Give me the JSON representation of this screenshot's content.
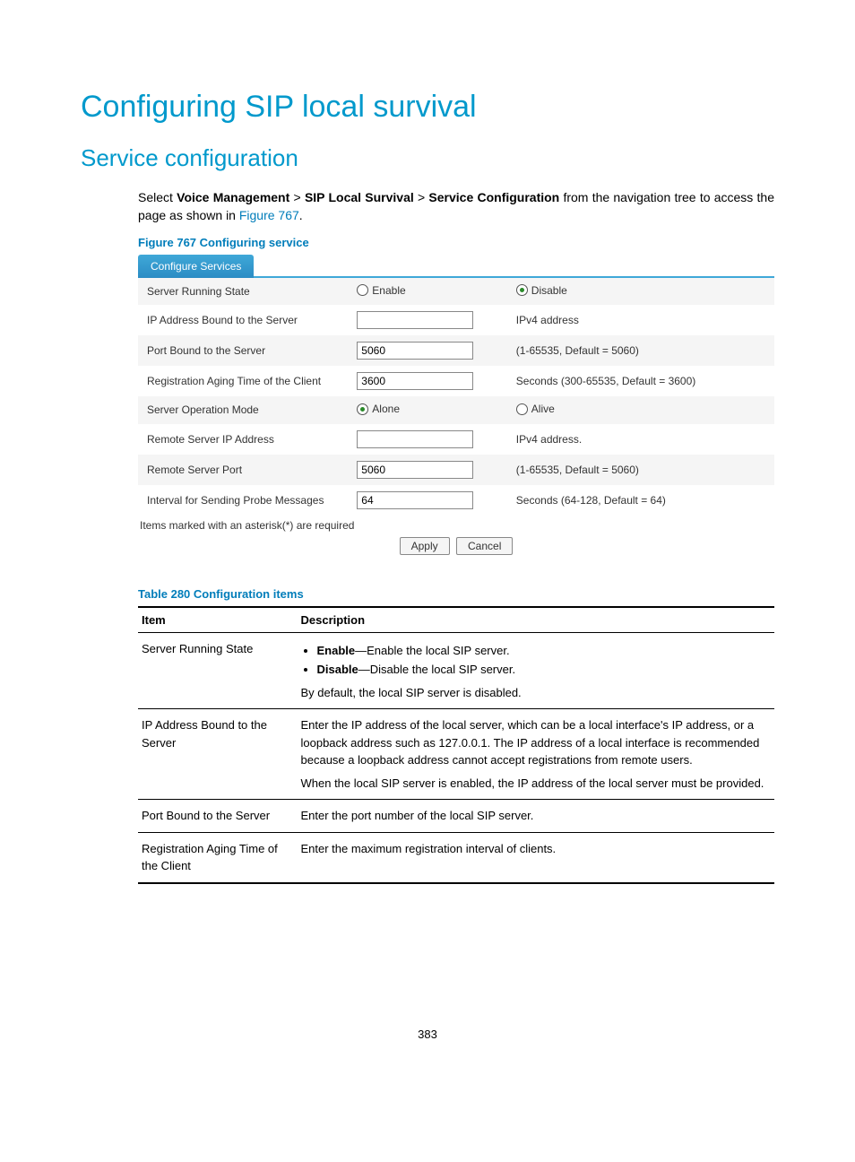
{
  "headings": {
    "h1": "Configuring SIP local survival",
    "h2": "Service configuration"
  },
  "intro": {
    "pre": "Select ",
    "b1": "Voice Management",
    "sep1": " > ",
    "b2": "SIP Local Survival",
    "sep2": " > ",
    "b3": "Service Configuration",
    "post": " from the navigation tree to access the page as shown in ",
    "link": "Figure 767",
    "end": "."
  },
  "figure_caption": "Figure 767 Configuring service",
  "form": {
    "tab": "Configure Services",
    "rows": {
      "r1": {
        "label": "Server Running State",
        "opt1": "Enable",
        "opt2": "Disable"
      },
      "r2": {
        "label": "IP Address Bound to the Server",
        "value": "",
        "hint": "IPv4 address"
      },
      "r3": {
        "label": "Port Bound to the Server",
        "value": "5060",
        "hint": "(1-65535, Default = 5060)"
      },
      "r4": {
        "label": "Registration Aging Time of the Client",
        "value": "3600",
        "hint": "Seconds (300-65535, Default = 3600)"
      },
      "r5": {
        "label": "Server Operation Mode",
        "opt1": "Alone",
        "opt2": "Alive"
      },
      "r6": {
        "label": "Remote Server IP Address",
        "value": "",
        "hint": "IPv4 address."
      },
      "r7": {
        "label": "Remote Server Port",
        "value": "5060",
        "hint": "(1-65535, Default = 5060)"
      },
      "r8": {
        "label": "Interval for Sending Probe Messages",
        "value": "64",
        "hint": "Seconds (64-128, Default = 64)"
      }
    },
    "note": "Items marked with an asterisk(*) are required",
    "apply": "Apply",
    "cancel": "Cancel"
  },
  "table_caption": "Table 280 Configuration items",
  "desc": {
    "h_item": "Item",
    "h_desc": "Description",
    "r1_item": "Server Running State",
    "r1_b1": "Enable",
    "r1_t1": "—Enable the local SIP server.",
    "r1_b2": "Disable",
    "r1_t2": "—Disable the local SIP server.",
    "r1_p": "By default, the local SIP server is disabled.",
    "r2_item": "IP Address Bound to the Server",
    "r2_p1": "Enter the IP address of the local server, which can be a local interface's IP address, or a loopback address such as 127.0.0.1. The IP address of a local interface is recommended because a loopback address cannot accept registrations from remote users.",
    "r2_p2": "When the local SIP server is enabled, the IP address of the local server must be provided.",
    "r3_item": "Port Bound to the Server",
    "r3_p": "Enter the port number of the local SIP server.",
    "r4_item": "Registration Aging Time of the Client",
    "r4_p": "Enter the maximum registration interval of clients."
  },
  "page_number": "383"
}
